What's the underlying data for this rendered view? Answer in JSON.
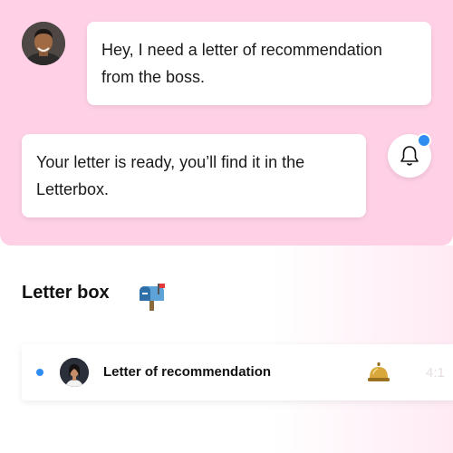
{
  "conversation": {
    "user_message_lines": [
      "Hey, I need a letter of recommendation",
      "from the boss."
    ],
    "bot_message_lines": [
      "Your letter is ready, you’ll find it in the",
      "Letterbox."
    ],
    "icons": {
      "user_avatar": "person-avatar",
      "notification": "bell-icon"
    },
    "colors": {
      "panel_background": "#ffd0e6",
      "bubble_background": "#ffffff",
      "notification_dot": "#2f8cf0"
    }
  },
  "letterbox": {
    "title": "Letter box",
    "title_icon": "mailbox-icon",
    "items": [
      {
        "title": "Letter of recommendation",
        "time": "4:1",
        "unread": true,
        "avatar": "person-avatar",
        "badge_icon": "service-bell-icon"
      }
    ]
  }
}
